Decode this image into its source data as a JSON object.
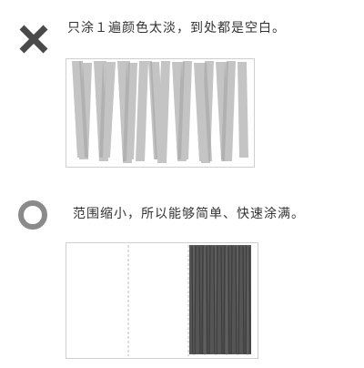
{
  "bad_example": {
    "icon": "cross-icon",
    "icon_color": "#4a4a4a",
    "caption": "只涂１遍颜色太淡，到处都是空白。"
  },
  "good_example": {
    "icon": "circle-icon",
    "icon_color": "#8a8a8a",
    "caption": "范围缩小，所以能够简单、快速涂满。"
  },
  "colors": {
    "light_stroke": "#c4c4c4",
    "dark_stroke": "#4d4d4d",
    "border": "#cfcfcf"
  }
}
